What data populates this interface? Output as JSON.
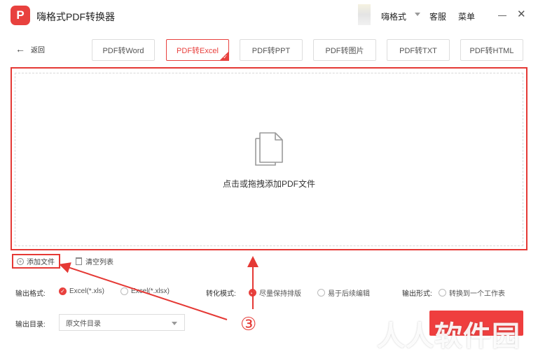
{
  "app": {
    "title": "嗨格式PDF转换器",
    "logo_letter": "P",
    "brand_color": "#e8413e"
  },
  "header": {
    "username": "嗨格式",
    "service_label": "客服",
    "menu_label": "菜单"
  },
  "nav": {
    "back_label": "返回",
    "tabs": [
      {
        "label": "PDF转Word",
        "active": false
      },
      {
        "label": "PDF转Excel",
        "active": true
      },
      {
        "label": "PDF转PPT",
        "active": false
      },
      {
        "label": "PDF转图片",
        "active": false
      },
      {
        "label": "PDF转TXT",
        "active": false
      },
      {
        "label": "PDF转HTML",
        "active": false
      }
    ]
  },
  "dropzone": {
    "prompt": "点击或拖拽添加PDF文件",
    "icon": "file-stack-icon"
  },
  "actions": {
    "add_file_label": "添加文件",
    "clear_list_label": "清空列表"
  },
  "options": {
    "output_format_label": "输出格式:",
    "formats": [
      {
        "label": "Excel(*.xls)",
        "checked": true
      },
      {
        "label": "Excel(*.xlsx)",
        "checked": false
      }
    ],
    "mode_label": "转化模式:",
    "modes": [
      {
        "label": "尽量保持排版",
        "checked": true
      },
      {
        "label": "易于后续编辑",
        "checked": false
      }
    ],
    "form_label": "输出形式:",
    "forms": [
      {
        "label": "转换到一个工作表",
        "checked": false
      }
    ],
    "output_dir_label": "输出目录:",
    "output_dir_value": "原文件目录"
  },
  "annotation": {
    "step_number": "③",
    "color": "#e53935"
  },
  "watermark": {
    "text": "人人软件园"
  }
}
